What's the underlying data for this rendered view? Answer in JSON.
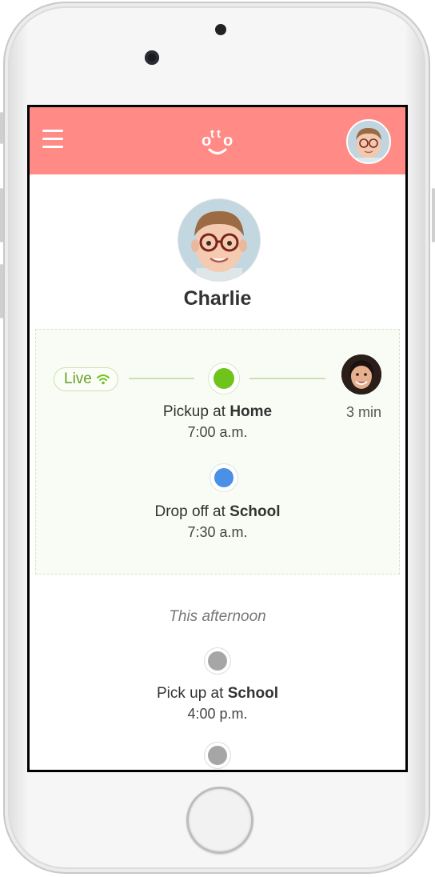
{
  "app": {
    "logo_text": "otto"
  },
  "profile": {
    "name": "Charlie"
  },
  "live_card": {
    "badge_label": "Live",
    "eta": "3 min",
    "stops": [
      {
        "prefix": "Pickup at ",
        "place": "Home",
        "time": "7:00 a.m."
      },
      {
        "prefix": "Drop off at ",
        "place": "School",
        "time": "7:30 a.m."
      }
    ]
  },
  "afternoon": {
    "label": "This afternoon",
    "stops": [
      {
        "prefix": "Pick up at ",
        "place": "School",
        "time": "4:00 p.m."
      }
    ]
  },
  "colors": {
    "header": "#ff8a86",
    "live_green": "#6fc41c",
    "drop_blue": "#4a90e6",
    "future_gray": "#a6a6a6",
    "card_bg": "#f9fcf4"
  },
  "icons": [
    "menu-icon",
    "wifi-icon",
    "avatar",
    "home-button"
  ]
}
